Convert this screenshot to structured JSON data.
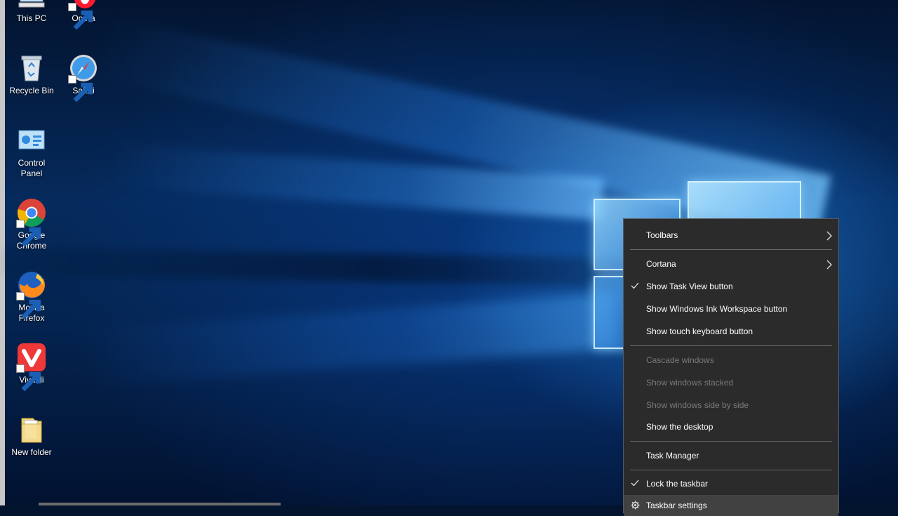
{
  "desktop_icons": [
    {
      "label": "This PC",
      "icon": "this-pc-icon"
    },
    {
      "label": "Opera",
      "icon": "opera-icon"
    },
    {
      "label": "Recycle Bin",
      "icon": "recycle-bin-icon"
    },
    {
      "label": "Safari",
      "icon": "safari-icon"
    },
    {
      "label": "Control Panel",
      "icon": "control-panel-icon"
    },
    {
      "label": "Google Chrome",
      "icon": "chrome-icon"
    },
    {
      "label": "Mozilla Firefox",
      "icon": "firefox-icon"
    },
    {
      "label": "Vivaldi",
      "icon": "vivaldi-icon"
    },
    {
      "label": "New folder",
      "icon": "folder-icon"
    }
  ],
  "context_menu": {
    "items": [
      {
        "label": "Toolbars",
        "submenu": true
      },
      {
        "label": "Cortana",
        "submenu": true
      },
      {
        "label": "Show Task View button",
        "checked": true
      },
      {
        "label": "Show Windows Ink Workspace button"
      },
      {
        "label": "Show touch keyboard button"
      },
      {
        "label": "Cascade windows",
        "disabled": true
      },
      {
        "label": "Show windows stacked",
        "disabled": true
      },
      {
        "label": "Show windows side by side",
        "disabled": true
      },
      {
        "label": "Show the desktop"
      },
      {
        "label": "Task Manager"
      },
      {
        "label": "Lock the taskbar",
        "checked": true
      },
      {
        "label": "Taskbar settings",
        "icon": "gear-icon",
        "highlighted": true
      }
    ]
  },
  "colors": {
    "menu_bg": "#2b2b2b",
    "menu_disabled_text": "#7a7a7a",
    "desktop_accent": "#1e78dc"
  }
}
